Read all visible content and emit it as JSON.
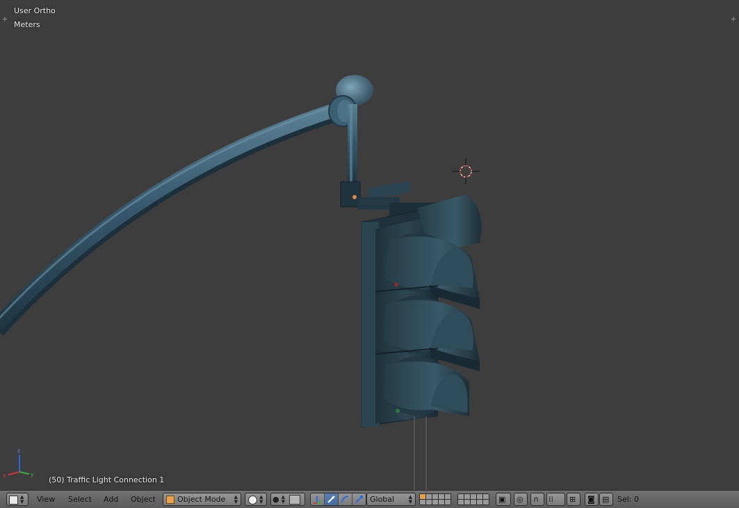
{
  "viewport": {
    "view_name": "User Ortho",
    "units": "Meters",
    "object_info": "(50) Traffic Light Connection 1",
    "axes": {
      "x": "x",
      "y": "y",
      "z": "z"
    }
  },
  "header": {
    "editor_type_icon": "cube-icon",
    "menus": [
      "View",
      "Select",
      "Add",
      "Object"
    ],
    "mode": "Object Mode",
    "transform_orientation": "Global",
    "selection_status": "Sel: 0"
  },
  "colors": {
    "viewport_bg": "#3d3d3d",
    "header_bg": "#6a6a6a",
    "model": "#2e4a58",
    "active_button": "#5b7fb0"
  }
}
